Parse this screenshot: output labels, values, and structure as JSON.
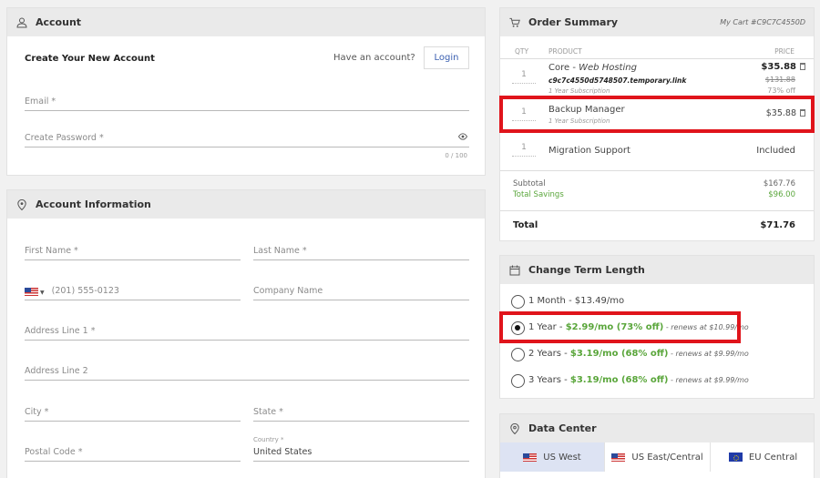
{
  "account": {
    "header": "Account",
    "create_title": "Create Your New Account",
    "have_account": "Have an account?",
    "login_label": "Login",
    "email_placeholder": "Email *",
    "password_placeholder": "Create Password *",
    "password_counter": "0 / 100"
  },
  "account_info": {
    "header": "Account Information",
    "first_name": "First Name *",
    "last_name": "Last Name *",
    "phone_placeholder": "(201) 555-0123",
    "company": "Company Name",
    "address1": "Address Line 1 *",
    "address2": "Address Line 2",
    "city": "City *",
    "state": "State *",
    "postal": "Postal Code *",
    "country_label": "Country *",
    "country_value": "United States"
  },
  "order": {
    "header": "Order Summary",
    "cart_id": "My Cart #C9C7C4550D",
    "col_qty": "QTY",
    "col_product": "PRODUCT",
    "col_price": "PRICE",
    "items": [
      {
        "qty": "1",
        "name_main": "Core - ",
        "name_italic": "Web Hosting",
        "domain": "c9c7c4550d5748507.temporary.link",
        "sub": "1 Year Subscription",
        "price": "$35.88",
        "old_price": "$131.88",
        "discount": "73% off"
      },
      {
        "qty": "1",
        "name_main": "Backup Manager",
        "sub": "1 Year Subscription",
        "price": "$35.88"
      },
      {
        "qty": "1",
        "name_main": "Migration Support",
        "price": "Included"
      }
    ],
    "subtotal_label": "Subtotal",
    "subtotal_value": "$167.76",
    "savings_label": "Total Savings",
    "savings_value": "$96.00",
    "total_label": "Total",
    "total_value": "$71.76"
  },
  "term": {
    "header": "Change Term Length",
    "options": [
      {
        "label": "1 Month - $13.49/mo",
        "green": "",
        "renew": "",
        "selected": false
      },
      {
        "label": "1 Year - ",
        "green": "$2.99/mo (73% off)",
        "renew": " - renews at $10.99/mo",
        "selected": true
      },
      {
        "label": "2 Years - ",
        "green": "$3.19/mo (68% off)",
        "renew": " - renews at $9.99/mo",
        "selected": false
      },
      {
        "label": "3 Years - ",
        "green": "$3.19/mo (68% off)",
        "renew": " - renews at $9.99/mo",
        "selected": false
      }
    ]
  },
  "datacenter": {
    "header": "Data Center",
    "options": [
      "US West",
      "US East/Central",
      "EU Central"
    ],
    "selected": "US West"
  },
  "colors": {
    "accent_green": "#5aa63b",
    "highlight_red": "#e0141b",
    "selected_dc": "#dde3f3"
  }
}
